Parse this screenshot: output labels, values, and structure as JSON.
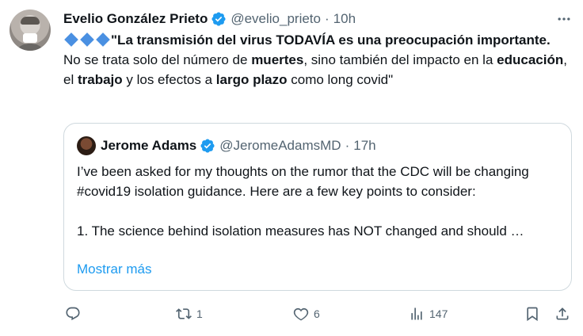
{
  "tweet": {
    "author_name": "Evelio González Prieto",
    "author_handle": "@evelio_prieto",
    "separator": "·",
    "time": "10h",
    "line1_bold": "\"La transmisión del virus TODAVÍA es una preocupación importante.",
    "line2_a": "No se trata solo del número de ",
    "line2_b": "muertes",
    "line2_c": ", sino también del impacto en la ",
    "line2_d": "educación",
    "line2_e": ", el ",
    "line2_f": "trabajo",
    "line2_g": " y los efectos a ",
    "line2_h": "largo plazo",
    "line2_i": " como long covid\"",
    "emoji_count_icon": "blue-diamond-icon"
  },
  "quote": {
    "author_name": "Jerome Adams",
    "author_handle": "@JeromeAdamsMD",
    "separator": "·",
    "time": "17h",
    "paragraph1": "I’ve been asked for my thoughts on the rumor that the CDC will be changing #covid19 isolation guidance. Here are a few key points to consider:",
    "paragraph2": "1. The science behind isolation measures has NOT changed and should …",
    "show_more": "Mostrar más"
  },
  "actions": {
    "reply_count": "",
    "retweet_count": "1",
    "like_count": "6",
    "views_count": "147"
  },
  "colors": {
    "accent": "#1d9bf0",
    "muted": "#536471",
    "border": "#cfd9de"
  }
}
